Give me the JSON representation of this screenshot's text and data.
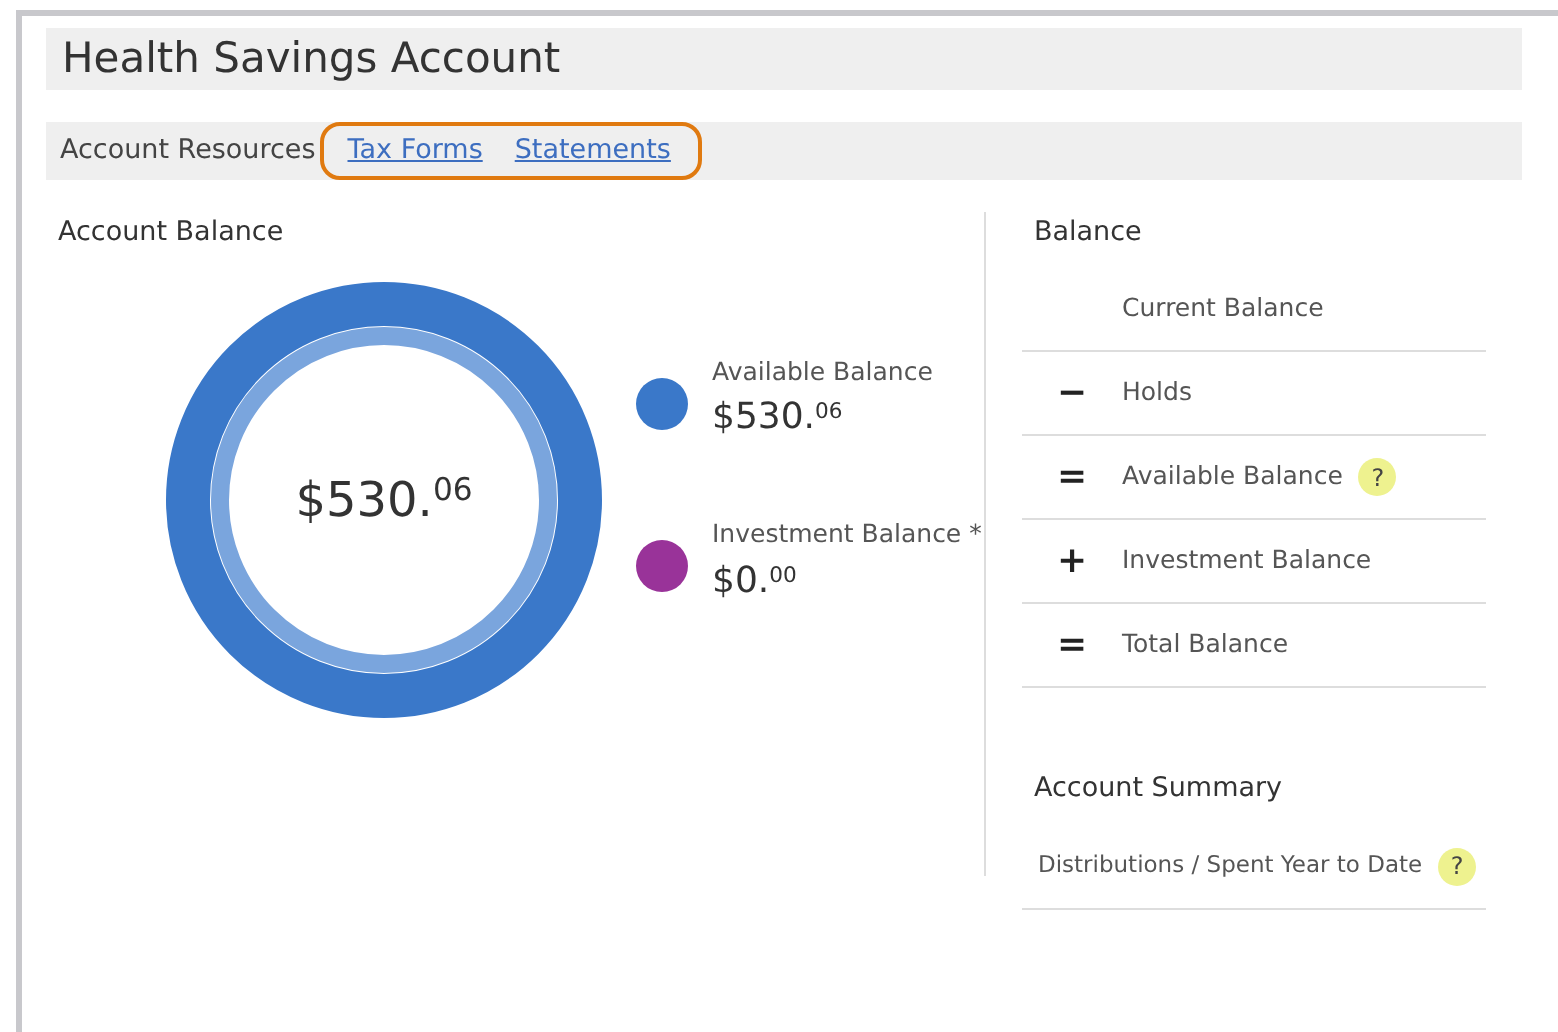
{
  "title": "Health Savings Account",
  "resources": {
    "label": "Account Resources",
    "links": [
      {
        "label": "Tax Forms"
      },
      {
        "label": "Statements"
      }
    ],
    "highlighted": true
  },
  "account_balance": {
    "heading": "Account Balance",
    "total": "$530.$^{06}$",
    "legend": [
      {
        "label": "Available Balance",
        "amount": "$530.$^{06}$",
        "color": "#3a78c9"
      },
      {
        "label": "Investment Balance *",
        "amount": "$0.$^{00}$",
        "color": "#993399"
      }
    ]
  },
  "balance": {
    "heading": "Balance",
    "rows": [
      {
        "operator": "",
        "label": "Current Balance"
      },
      {
        "operator": "−",
        "label": "Holds"
      },
      {
        "operator": "=",
        "label": "Available Balance",
        "help": "?"
      },
      {
        "operator": "+",
        "label": "Investment Balance"
      },
      {
        "operator": "=",
        "label": "Total Balance"
      }
    ]
  },
  "summary": {
    "heading": "Account Summary",
    "rows": [
      {
        "label": "Distributions / Spent Year to Date",
        "help": "?"
      }
    ]
  }
}
